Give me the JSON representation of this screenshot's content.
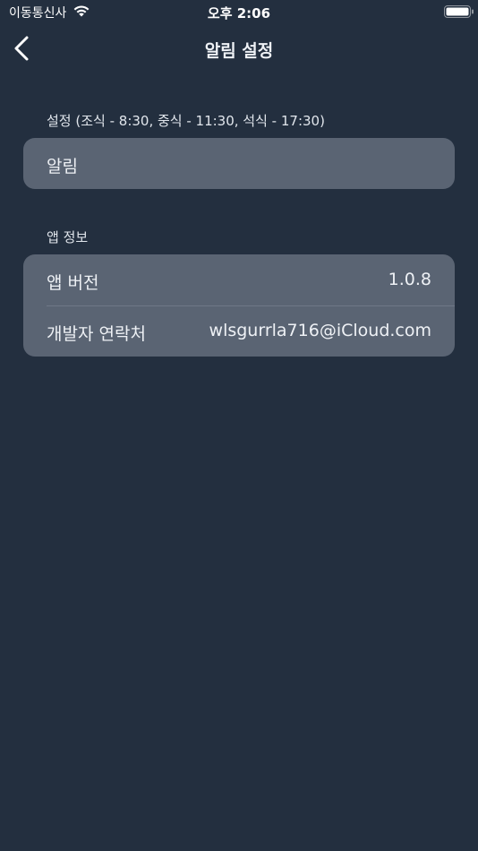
{
  "status_bar": {
    "carrier": "이동통신사",
    "time": "오후 2:06"
  },
  "nav": {
    "title": "알림 설정",
    "back_icon": "chevron-left-icon"
  },
  "sections": {
    "settings": {
      "header": "설정  (조식 - 8:30, 중식 - 11:30, 석식 - 17:30)",
      "rows": [
        {
          "label": "알림"
        }
      ]
    },
    "app_info": {
      "header": "앱 정보",
      "rows": [
        {
          "label": "앱 버전",
          "value": "1.0.8"
        },
        {
          "label": "개발자 연락처",
          "value": "wlsgurrla716@iCloud.com"
        }
      ]
    }
  },
  "colors": {
    "background": "#232f3f",
    "card": "#5a6473",
    "text": "#eef1f5"
  }
}
